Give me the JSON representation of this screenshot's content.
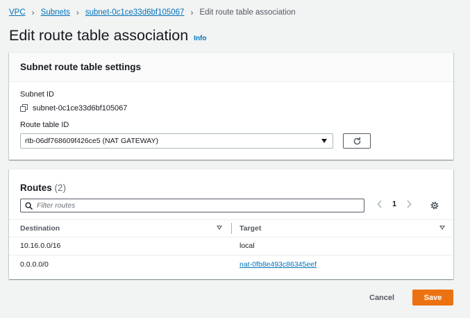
{
  "breadcrumb": {
    "items": [
      "VPC",
      "Subnets",
      "subnet-0c1ce33d6bf105067"
    ],
    "current": "Edit route table association"
  },
  "header": {
    "title": "Edit route table association",
    "info_link": "Info"
  },
  "settings_panel": {
    "title": "Subnet route table settings",
    "subnet_id_label": "Subnet ID",
    "subnet_id_value": "subnet-0c1ce33d6bf105067",
    "route_table_label": "Route table ID",
    "route_table_selected": "rtb-06df768609f426ce5 (NAT GATEWAY)"
  },
  "routes_panel": {
    "title": "Routes",
    "count": "(2)",
    "filter_placeholder": "Filter routes",
    "page": "1",
    "columns": [
      "Destination",
      "Target"
    ],
    "rows": [
      {
        "destination": "10.16.0.0/16",
        "target": "local"
      },
      {
        "destination": "0.0.0.0/0",
        "target": "nat-0fb8e493c86345eef"
      }
    ]
  },
  "footer": {
    "cancel_label": "Cancel",
    "save_label": "Save"
  },
  "colors": {
    "accent": "#ec7211",
    "link": "#0073bb",
    "background": "#f2f3f3"
  }
}
